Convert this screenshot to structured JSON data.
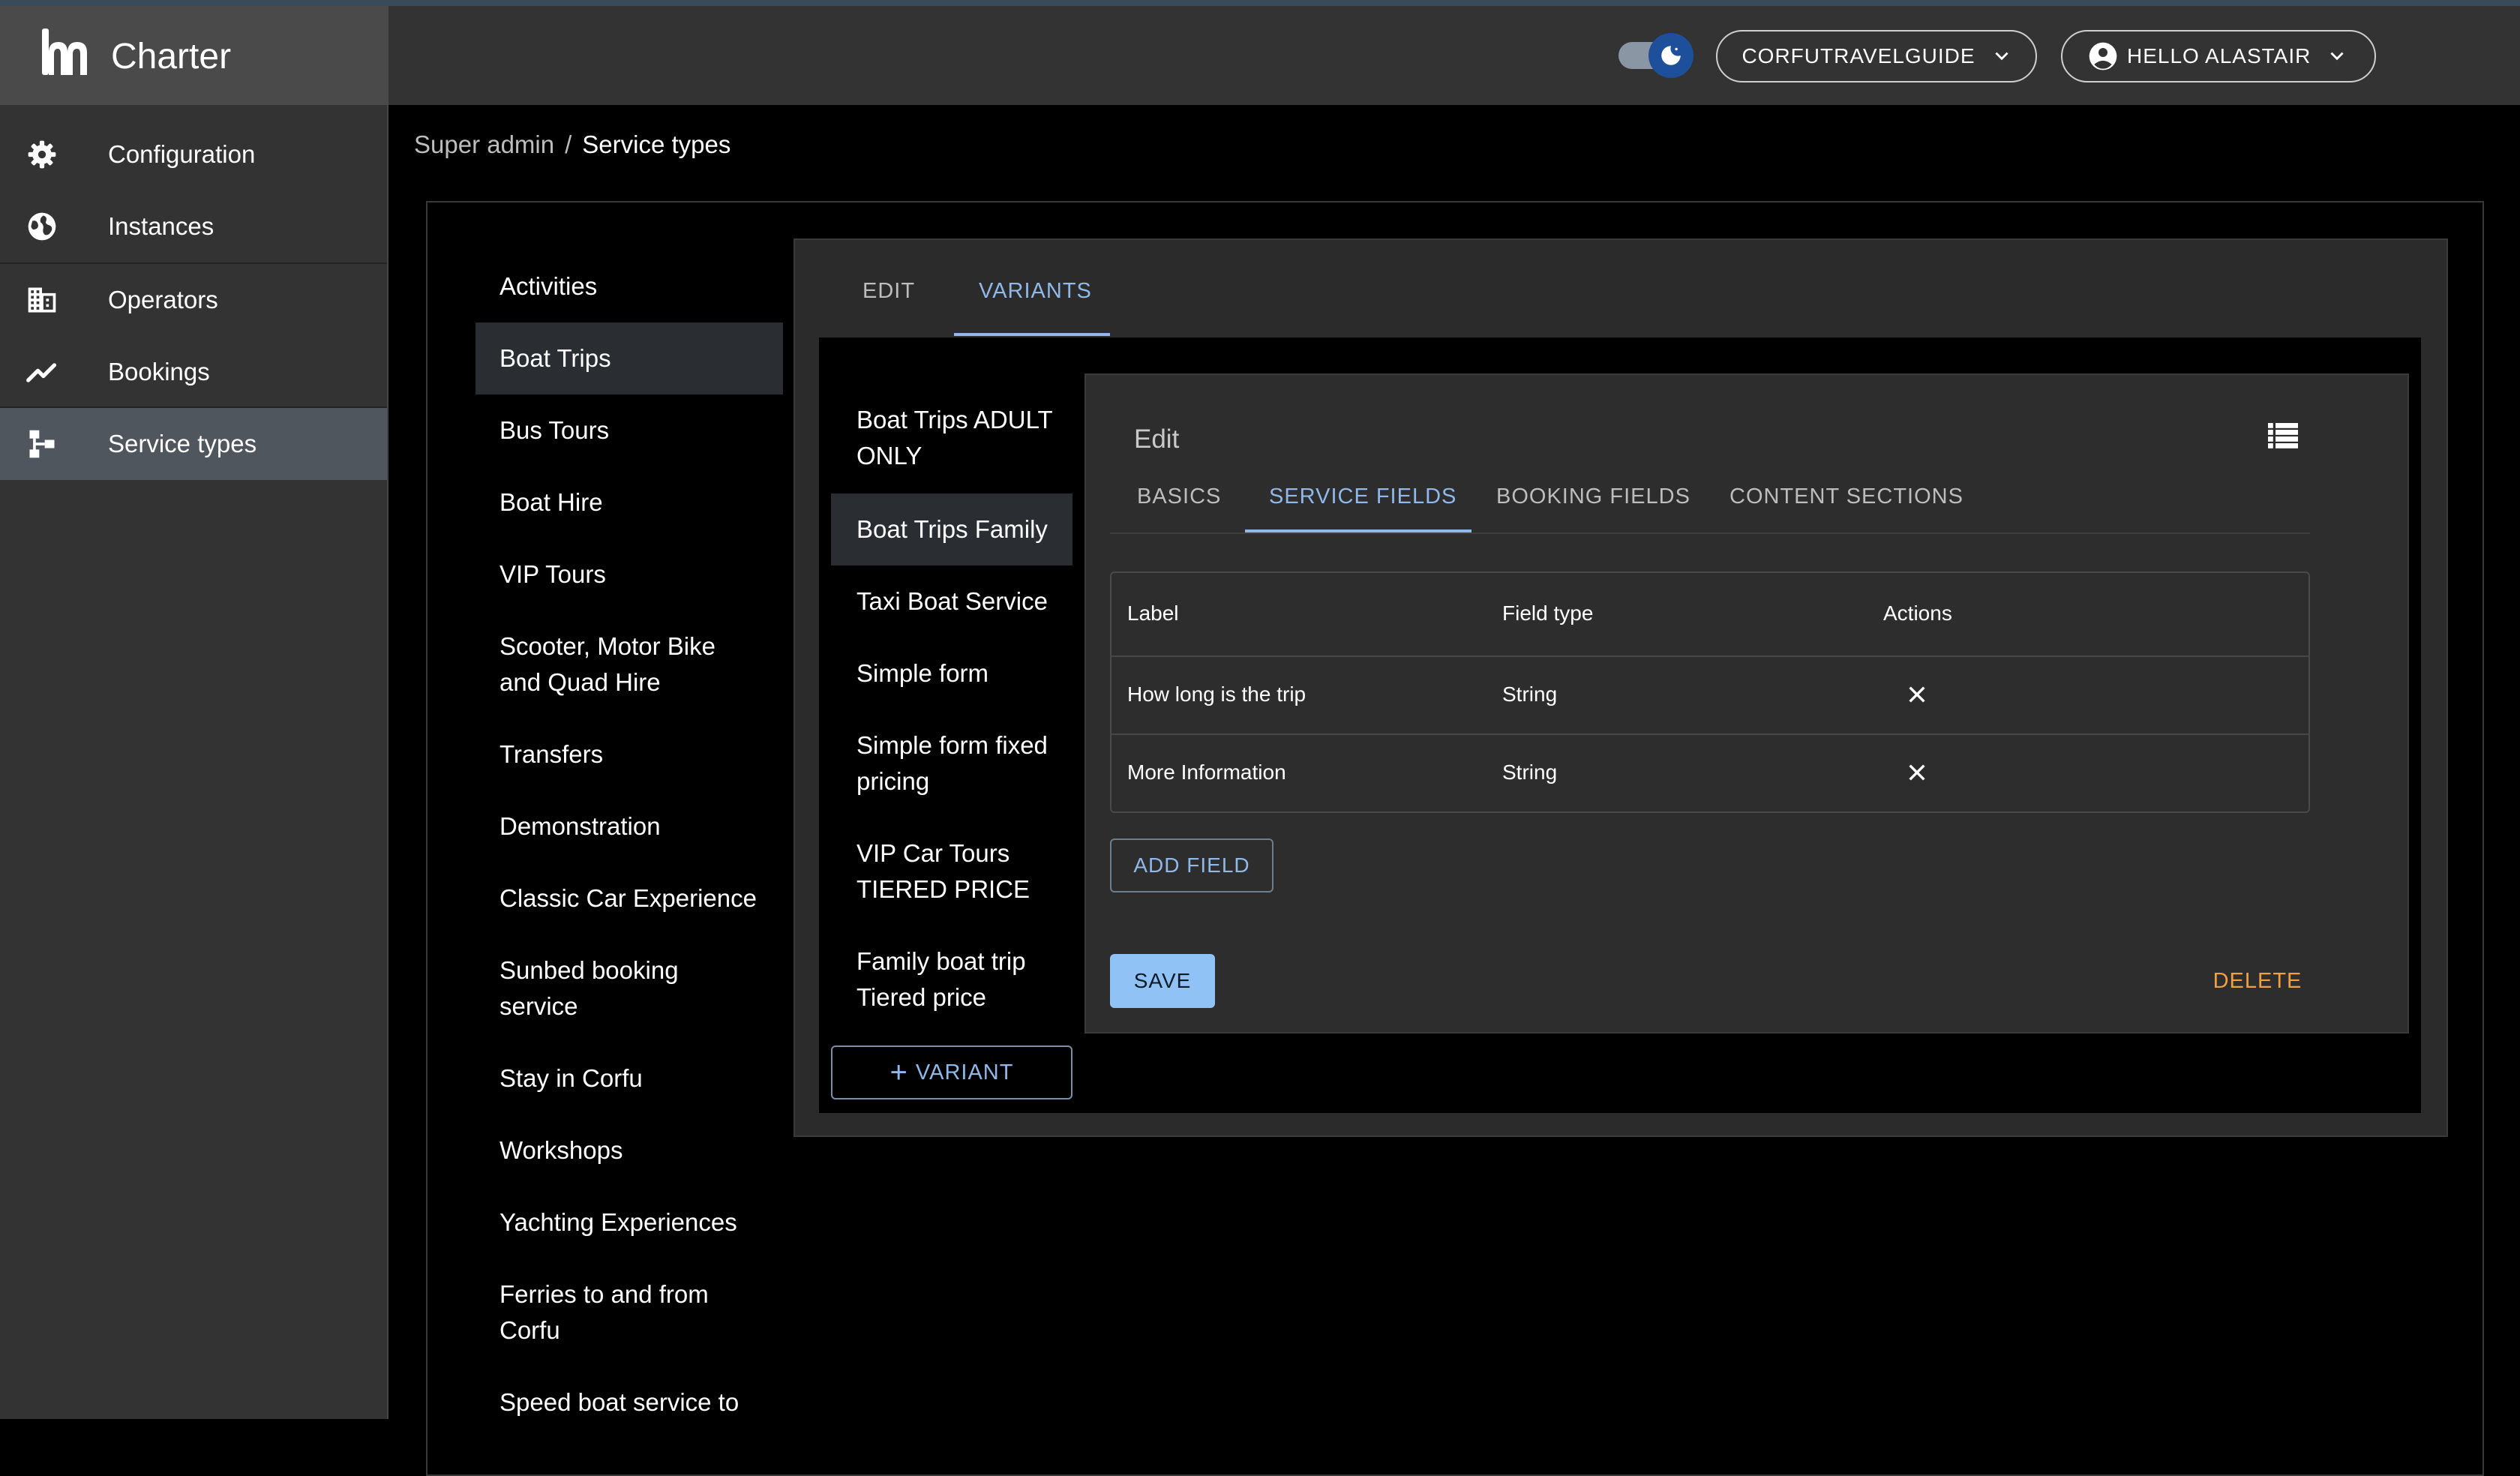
{
  "app": {
    "name": "Charter"
  },
  "header": {
    "org_select_label": "CORFUTRAVELGUIDE",
    "user_menu_label": "HELLO ALASTAIR"
  },
  "sidebar": {
    "items": [
      {
        "label": "Configuration",
        "icon": "gear-icon"
      },
      {
        "label": "Instances",
        "icon": "globe-icon"
      },
      {
        "label": "Operators",
        "icon": "building-icon"
      },
      {
        "label": "Bookings",
        "icon": "trending-icon"
      },
      {
        "label": "Service types",
        "icon": "account-tree-icon",
        "active": true
      }
    ]
  },
  "breadcrumb": {
    "parent": "Super admin",
    "separator": "/",
    "current": "Service types"
  },
  "service_types": [
    {
      "label": "Activities"
    },
    {
      "label": "Boat Trips",
      "active": true
    },
    {
      "label": "Bus Tours"
    },
    {
      "label": "Boat Hire"
    },
    {
      "label": "VIP Tours"
    },
    {
      "label": "Scooter, Motor Bike and Quad Hire"
    },
    {
      "label": "Transfers"
    },
    {
      "label": "Demonstration"
    },
    {
      "label": "Classic Car Experience"
    },
    {
      "label": "Sunbed booking service"
    },
    {
      "label": "Stay in Corfu"
    },
    {
      "label": "Workshops"
    },
    {
      "label": "Yachting Experiences"
    },
    {
      "label": "Ferries to and from Corfu"
    },
    {
      "label": "Speed boat service to"
    }
  ],
  "variant_tabs": [
    {
      "label": "EDIT"
    },
    {
      "label": "VARIANTS",
      "active": true
    }
  ],
  "variants": [
    {
      "label": "Boat Trips ADULT ONLY"
    },
    {
      "label": "Boat Trips Family",
      "active": true
    },
    {
      "label": "Taxi Boat Service"
    },
    {
      "label": "Simple form"
    },
    {
      "label": "Simple form fixed pricing"
    },
    {
      "label": "VIP Car Tours TIERED PRICE"
    },
    {
      "label": "Family boat trip Tiered price"
    }
  ],
  "add_variant_label": "VARIANT",
  "edit_panel": {
    "title": "Edit",
    "tabs": [
      {
        "label": "BASICS"
      },
      {
        "label": "SERVICE FIELDS",
        "active": true
      },
      {
        "label": "BOOKING FIELDS"
      },
      {
        "label": "CONTENT SECTIONS"
      }
    ],
    "table": {
      "headers": [
        "Label",
        "Field type",
        "Actions"
      ],
      "rows": [
        {
          "label": "How long is the trip",
          "field_type": "String"
        },
        {
          "label": "More Information",
          "field_type": "String"
        }
      ]
    },
    "add_field_label": "ADD FIELD",
    "save_label": "SAVE",
    "delete_label": "DELETE"
  },
  "colors": {
    "accent": "#90b8e8",
    "save_bg": "#90c2f5",
    "delete": "#f0a040",
    "toggle_knob": "#1e4f9a"
  }
}
